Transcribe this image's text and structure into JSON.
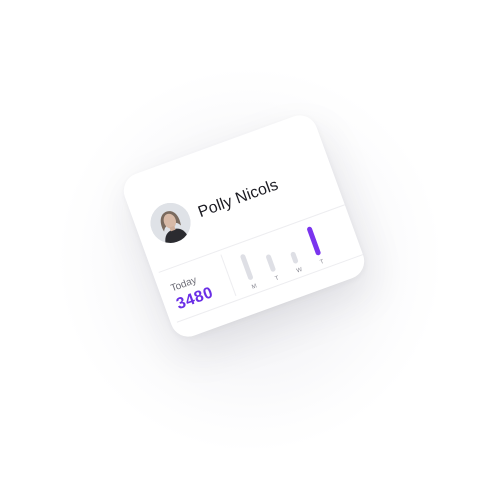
{
  "profile": {
    "name": "Polly Nicols",
    "avatar_icon": "user-photo"
  },
  "stats": {
    "today_label": "Today",
    "today_value": "3480"
  },
  "chart_data": {
    "type": "bar",
    "categories": [
      "M",
      "T",
      "W",
      "T"
    ],
    "values": [
      0.5,
      0.33,
      0.22,
      0.55
    ],
    "active_index": 3
  },
  "colors": {
    "accent": "#7a34ee",
    "value_text": "#6a2ee6",
    "inactive_bar": "#dedfe5"
  }
}
